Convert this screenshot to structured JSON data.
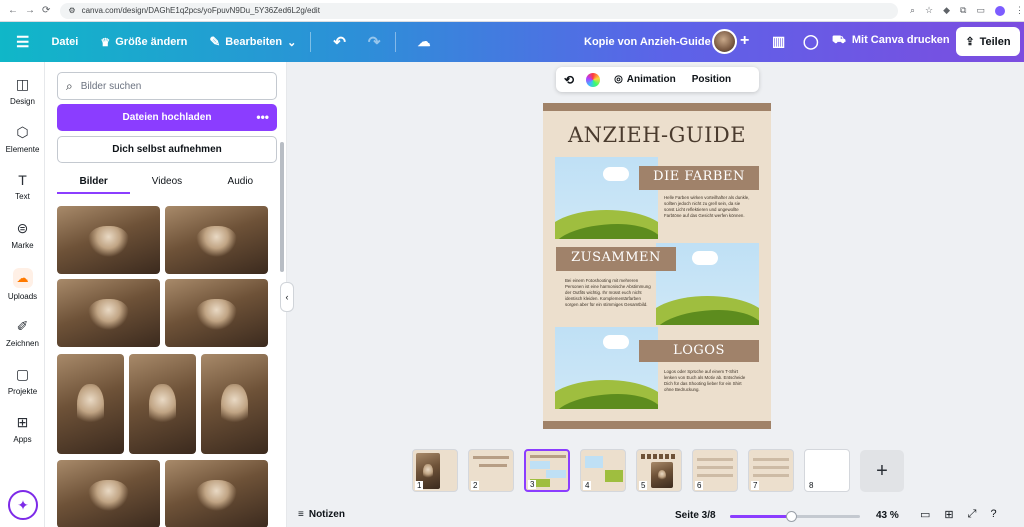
{
  "browser": {
    "url": "canva.com/design/DAGhE1q2pcs/yoFpuvN9Du_5Y36Zed6L2g/edit"
  },
  "topbar": {
    "menu_icon": "hamburger-icon",
    "file_label": "Datei",
    "resize_label": "Größe ändern",
    "edit_label": "Bearbeiten",
    "doc_title": "Kopie von Anzieh-Guide",
    "print_label": "Mit Canva drucken",
    "share_label": "Teilen",
    "brand_colors": {
      "start": "#10b7c8",
      "end": "#7c4de0"
    }
  },
  "rail": {
    "items": [
      {
        "label": "Design",
        "icon": "layout-icon"
      },
      {
        "label": "Elemente",
        "icon": "shapes-icon"
      },
      {
        "label": "Text",
        "icon": "text-icon"
      },
      {
        "label": "Marke",
        "icon": "brand-icon"
      },
      {
        "label": "Uploads",
        "icon": "upload-cloud-icon"
      },
      {
        "label": "Zeichnen",
        "icon": "pen-icon"
      },
      {
        "label": "Projekte",
        "icon": "folder-icon"
      },
      {
        "label": "Apps",
        "icon": "apps-icon"
      }
    ],
    "active": "Uploads"
  },
  "panel": {
    "search_placeholder": "Bilder suchen",
    "upload_label": "Dateien hochladen",
    "record_label": "Dich selbst aufnehmen",
    "tabs": [
      {
        "label": "Bilder",
        "active": true
      },
      {
        "label": "Videos",
        "active": false
      },
      {
        "label": "Audio",
        "active": false
      }
    ],
    "accent_color": "#8b3dff"
  },
  "context_toolbar": {
    "animation_label": "Animation",
    "position_label": "Position"
  },
  "page": {
    "title": "ANZIEH-GUIDE",
    "section1_label": "DIE FARBEN",
    "section1_text": "Helle Farben wirken vorteilhafter als dunkle, sollten jedoch nicht zu grell sein, da sie sonst Licht reflektieren und ungewollte Farbtöne auf das Gesicht werfen können.",
    "section2_label": "ZUSAMMEN",
    "section2_text": "Bei einem Fotoshooting mit mehreren Personen ist eine harmonische Abstimmung der Outfits wichtig. Ihr müsst euch nicht identisch kleiden. Komplementärfarben sorgen aber für ein stimmiges Gesamtbild.",
    "section3_label": "LOGOS",
    "section3_text": "Logos oder Sprüche auf einem T-Shirt lenken von Euch als Motiv ab. Entscheide Dich für das Shooting lieber für ein Shirt ohne Bedruckung.",
    "background_color": "#ecdfcd",
    "label_color": "#a0826a"
  },
  "thumbnails": {
    "pages": [
      "1",
      "2",
      "3",
      "4",
      "5",
      "6",
      "7",
      "8"
    ],
    "active": "3"
  },
  "bottom": {
    "notes_label": "Notizen",
    "page_indicator": "Seite 3/8",
    "zoom_label": "43 %",
    "zoom_percent": 43
  }
}
